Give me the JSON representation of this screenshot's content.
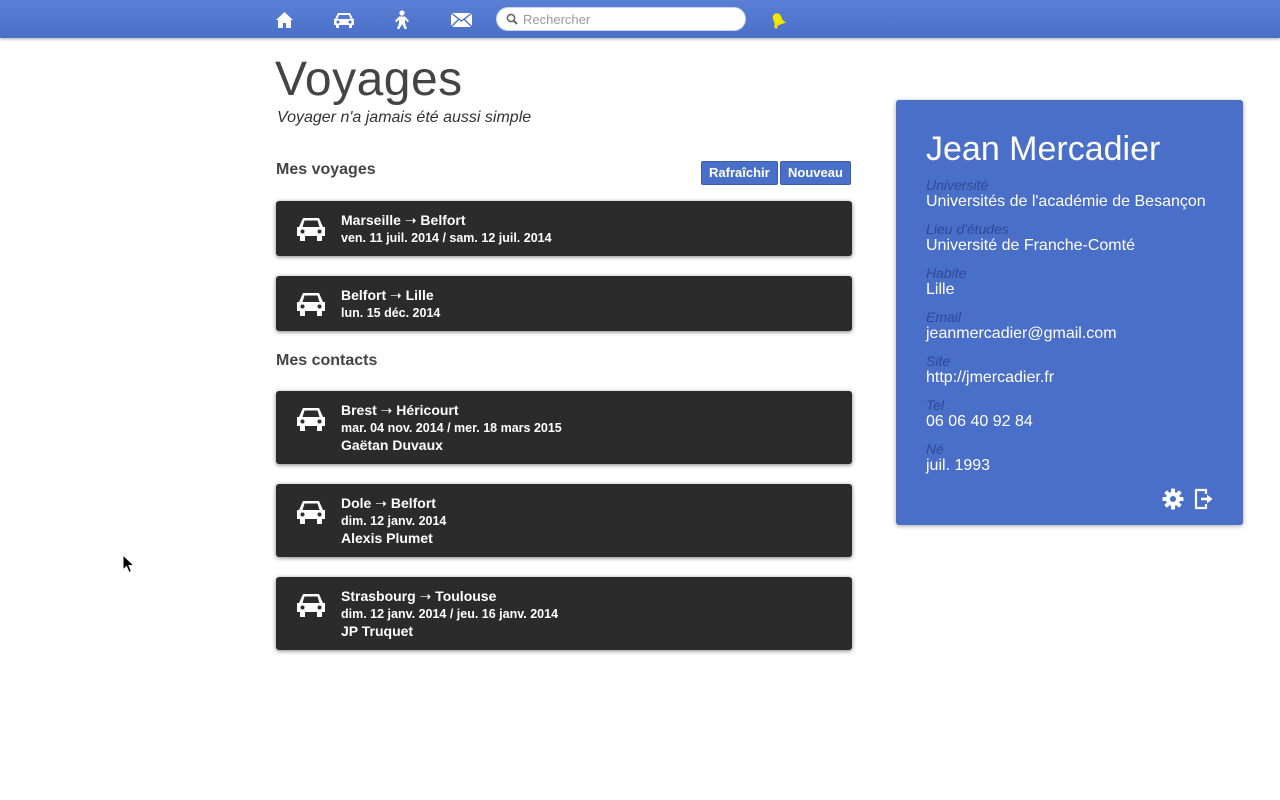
{
  "nav": {
    "icons": [
      "home-icon",
      "car-icon",
      "person-icon",
      "mail-icon",
      "bell-icon"
    ],
    "search_placeholder": "Rechercher"
  },
  "header": {
    "title": "Voyages",
    "subtitle": "Voyager n'a jamais été aussi simple"
  },
  "trips": {
    "section_title": "Mes voyages",
    "refresh_label": "Rafraîchir",
    "new_label": "Nouveau",
    "items": [
      {
        "route": "Marseille ➝ Belfort",
        "dates": "ven. 11 juil. 2014 / sam. 12 juil. 2014"
      },
      {
        "route": "Belfort ➝ Lille",
        "dates": "lun. 15 déc. 2014"
      }
    ]
  },
  "contacts": {
    "section_title": "Mes contacts",
    "items": [
      {
        "route": "Brest ➝ Héricourt",
        "dates": "mar. 04 nov. 2014 / mer. 18 mars 2015",
        "person": "Gaëtan Duvaux"
      },
      {
        "route": "Dole ➝ Belfort",
        "dates": "dim. 12 janv. 2014",
        "person": "Alexis Plumet"
      },
      {
        "route": "Strasbourg ➝ Toulouse",
        "dates": "dim. 12 janv. 2014 / jeu. 16 janv. 2014",
        "person": "JP Truquet"
      }
    ]
  },
  "profile": {
    "name": "Jean Mercadier",
    "fields": [
      {
        "label": "Université",
        "value": "Universités de l'académie de Besançon"
      },
      {
        "label": "Lieu d'études",
        "value": "Université de Franche-Comté"
      },
      {
        "label": "Habite",
        "value": "Lille"
      },
      {
        "label": "Email",
        "value": "jeanmercadier@gmail.com"
      },
      {
        "label": "Site",
        "value": "http://jmercadier.fr"
      },
      {
        "label": "Tel",
        "value": "06 06 40 92 84"
      },
      {
        "label": "Né",
        "value": "juil. 1993"
      }
    ]
  },
  "colors": {
    "topbar": "#4a6fc8",
    "card": "#2b2b2b",
    "panel": "#4a6fc8",
    "bell": "#f2e600"
  }
}
